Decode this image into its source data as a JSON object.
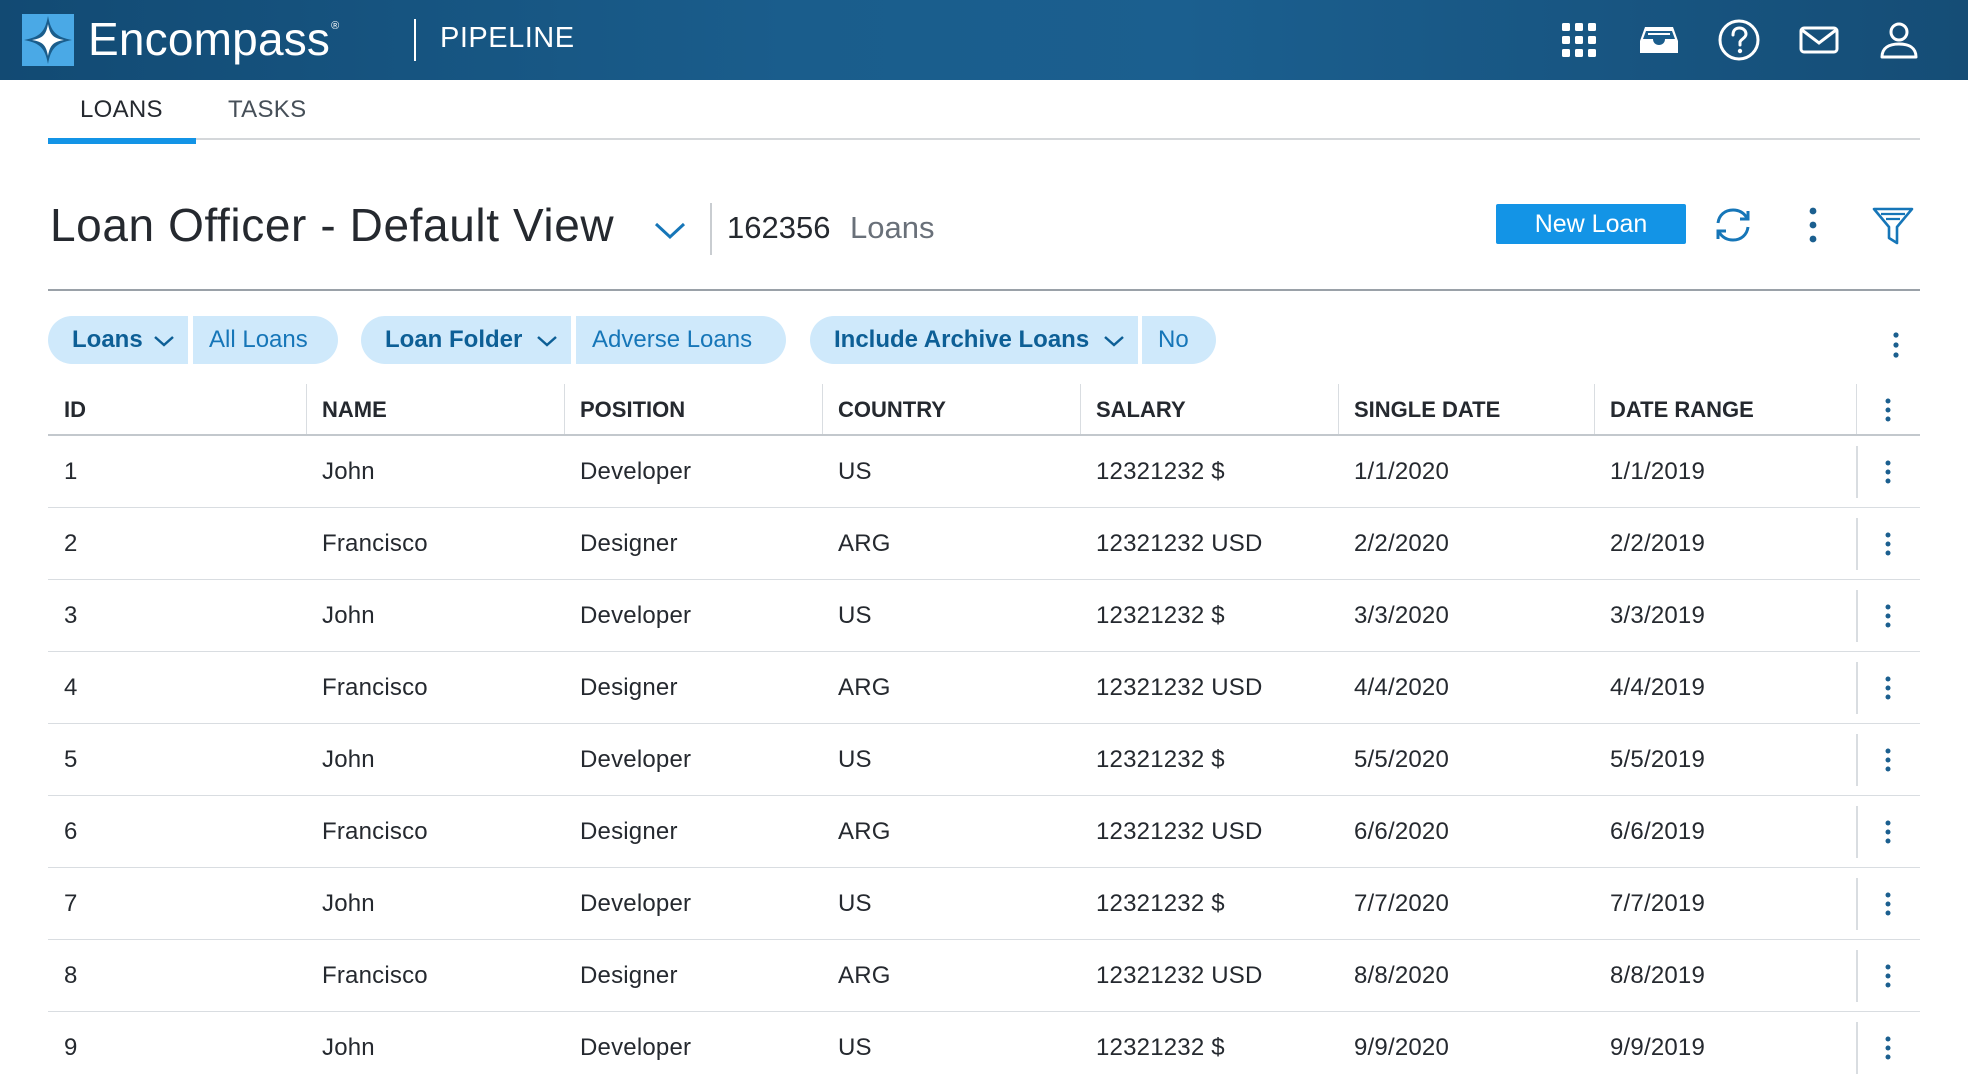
{
  "app": {
    "brand": "Encompass",
    "trademark": "®",
    "module": "PIPELINE",
    "header_icons": [
      "apps-grid-icon",
      "inbox-tray-icon",
      "help-icon",
      "mail-icon",
      "user-profile-icon"
    ]
  },
  "tabs": [
    {
      "label": "LOANS",
      "active": true
    },
    {
      "label": "TASKS",
      "active": false
    }
  ],
  "view": {
    "title": "Loan Officer - Default View",
    "count": "162356",
    "count_label": "Loans",
    "new_button": "New Loan"
  },
  "filters": [
    {
      "key": "Loans",
      "value": "All Loans"
    },
    {
      "key": "Loan Folder",
      "value": "Adverse Loans"
    },
    {
      "key": "Include Archive Loans",
      "value": "No"
    }
  ],
  "table": {
    "columns": [
      "ID",
      "NAME",
      "POSITION",
      "COUNTRY",
      "SALARY",
      "SINGLE DATE",
      "DATE RANGE"
    ],
    "rows": [
      [
        "1",
        "John",
        "Developer",
        "US",
        "12321232 $",
        "1/1/2020",
        "1/1/2019"
      ],
      [
        "2",
        "Francisco",
        "Designer",
        "ARG",
        "12321232 USD",
        "2/2/2020",
        "2/2/2019"
      ],
      [
        "3",
        "John",
        "Developer",
        "US",
        "12321232 $",
        "3/3/2020",
        "3/3/2019"
      ],
      [
        "4",
        "Francisco",
        "Designer",
        "ARG",
        "12321232 USD",
        "4/4/2020",
        "4/4/2019"
      ],
      [
        "5",
        "John",
        "Developer",
        "US",
        "12321232 $",
        "5/5/2020",
        "5/5/2019"
      ],
      [
        "6",
        "Francisco",
        "Designer",
        "ARG",
        "12321232 USD",
        "6/6/2020",
        "6/6/2019"
      ],
      [
        "7",
        "John",
        "Developer",
        "US",
        "12321232 $",
        "7/7/2020",
        "7/7/2019"
      ],
      [
        "8",
        "Francisco",
        "Designer",
        "ARG",
        "12321232 USD",
        "8/8/2020",
        "8/8/2019"
      ],
      [
        "9",
        "John",
        "Developer",
        "US",
        "12321232 $",
        "9/9/2020",
        "9/9/2019"
      ]
    ]
  },
  "colors": {
    "header_bg": "#1a5d8c",
    "accent": "#1394e6",
    "pill_bg": "#cfe9fb"
  }
}
